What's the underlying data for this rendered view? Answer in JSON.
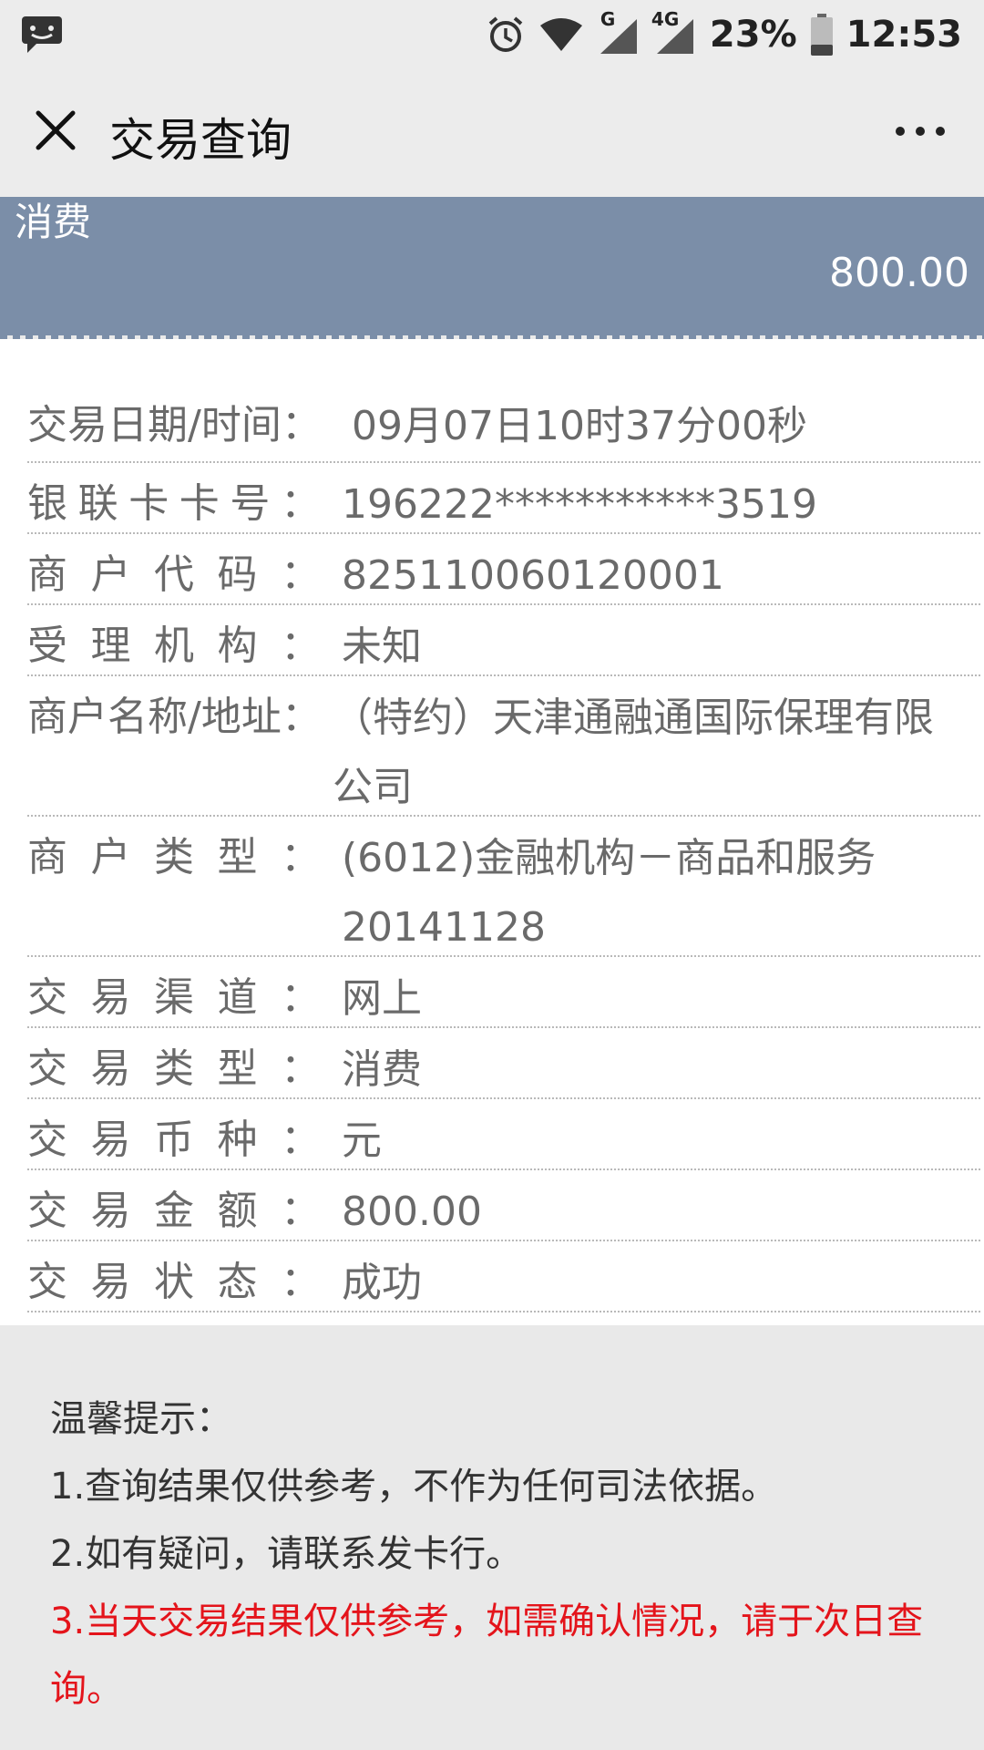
{
  "status_bar": {
    "battery": "23%",
    "time": "12:53",
    "signal_label_1": "G",
    "signal_label_2": "4G",
    "icons": [
      "chat-icon",
      "alarm-icon",
      "wifi-icon",
      "signal-icon",
      "signal-4g-icon",
      "battery-icon"
    ]
  },
  "header": {
    "title": "交易查询"
  },
  "summary": {
    "type": "消费",
    "amount": "800.00"
  },
  "details": [
    {
      "label": "交易日期/时间：",
      "value": "09月07日10时37分00秒"
    },
    {
      "label": "银联卡卡号：",
      "value": "196222***********3519"
    },
    {
      "label": "商户代码：",
      "value": "825110060120001"
    },
    {
      "label": "受理机构：",
      "value": "未知"
    },
    {
      "label": "商户名称/地址：",
      "value": "（特约）天津通融通国际保理有限公司"
    },
    {
      "label": "商户类型：",
      "value": "(6012)金融机构－商品和服务20141128"
    },
    {
      "label": "交易渠道：",
      "value": "网上"
    },
    {
      "label": "交易类型：",
      "value": "消费"
    },
    {
      "label": "交易币种：",
      "value": "元"
    },
    {
      "label": "交易金额：",
      "value": "800.00"
    },
    {
      "label": "交易状态：",
      "value": "成功"
    }
  ],
  "tips": {
    "title": "温馨提示：",
    "item1": "1.查询结果仅供参考，不作为任何司法依据。",
    "item2": "2.如有疑问，请联系发卡行。",
    "item3": "3.当天交易结果仅供参考，如需确认情况，请于次日查询。"
  },
  "colors": {
    "banner": "#7b8ea8",
    "warning": "#e4141b"
  }
}
